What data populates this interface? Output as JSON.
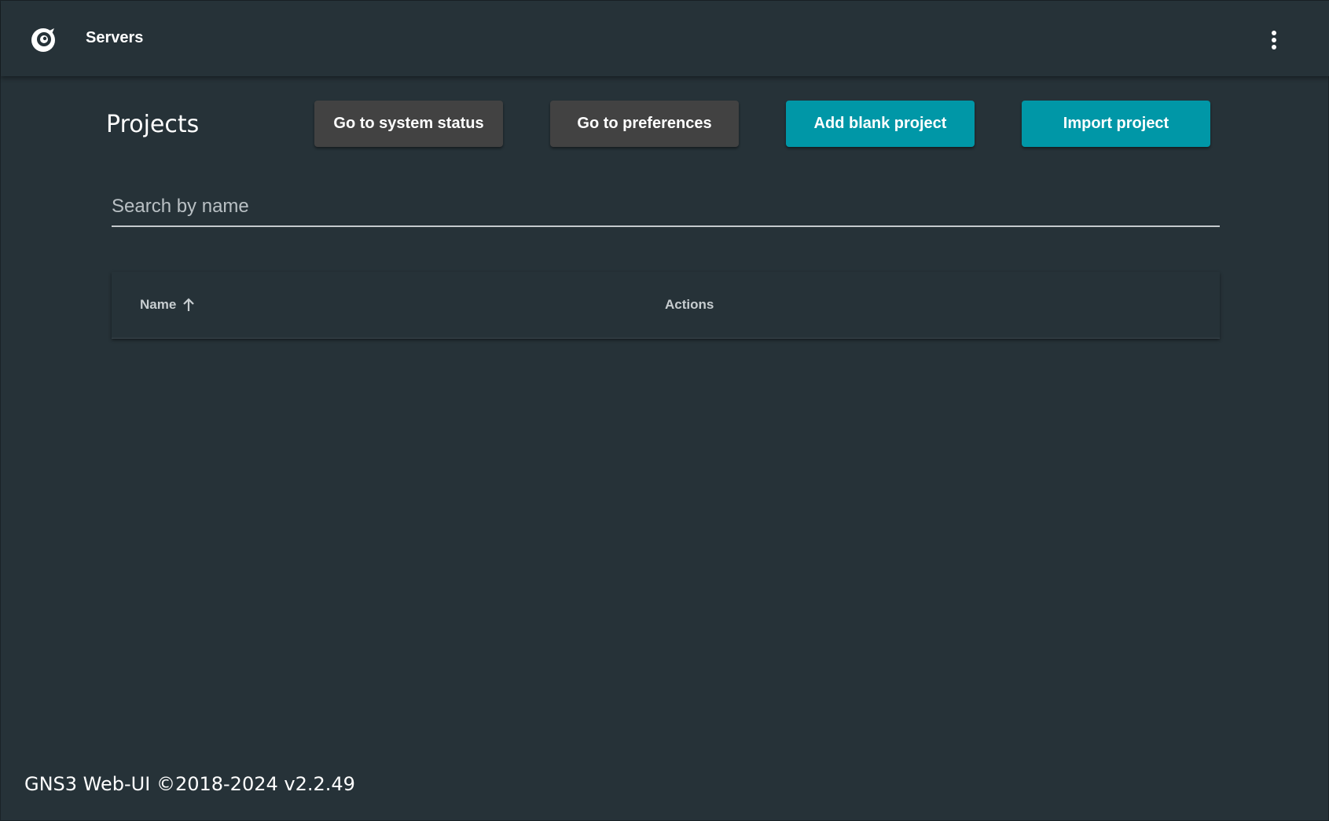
{
  "toolbar": {
    "title": "Servers",
    "logo_icon": "gns3-chameleon-logo-icon",
    "menu_icon": "more-vertical-icon"
  },
  "page": {
    "title": "Projects"
  },
  "actions": {
    "system_status": "Go to system status",
    "preferences": "Go to preferences",
    "add_blank": "Add blank project",
    "import": "Import project"
  },
  "search": {
    "placeholder": "Search by name",
    "value": ""
  },
  "table": {
    "columns": {
      "name": "Name",
      "actions": "Actions"
    },
    "sort": {
      "column": "Name",
      "direction": "ascending"
    },
    "rows": []
  },
  "footer": {
    "text": "GNS3 Web-UI ©2018-2024 v2.2.49"
  },
  "colors": {
    "background": "#263238",
    "button_dark": "#424242",
    "button_accent": "#0097a7"
  }
}
